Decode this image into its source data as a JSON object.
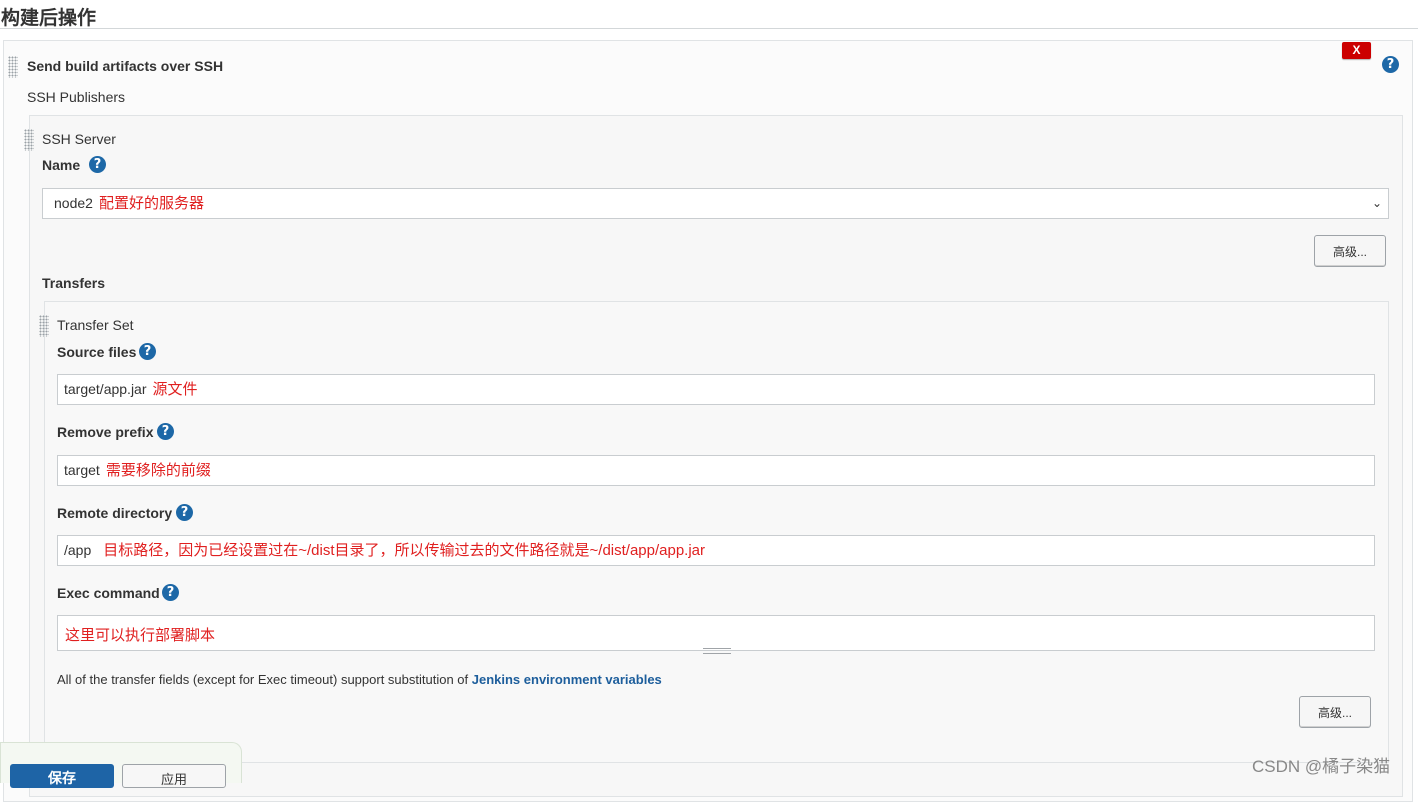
{
  "section": {
    "title": "构建后操作"
  },
  "step": {
    "title": "Send build artifacts over SSH",
    "delete_label": "X",
    "help_icon": "?",
    "publishers_label": "SSH Publishers"
  },
  "server": {
    "label": "SSH Server",
    "name_label": "Name",
    "name_value": "node2",
    "name_annotation": "配置好的服务器",
    "advanced_label": "高级..."
  },
  "transfers": {
    "label": "Transfers",
    "set_label": "Transfer Set",
    "source_files_label": "Source files",
    "source_files_value": "target/app.jar",
    "source_files_annotation": "源文件",
    "remove_prefix_label": "Remove prefix",
    "remove_prefix_value": "target",
    "remove_prefix_annotation": "需要移除的前缀",
    "remote_directory_label": "Remote directory",
    "remote_directory_value": "/app",
    "remote_directory_annotation": "目标路径，因为已经设置过在~/dist目录了，所以传输过去的文件路径就是~/dist/app/app.jar",
    "exec_command_label": "Exec command",
    "exec_command_annotation": "这里可以执行部署脚本",
    "note_text": "All of the transfer fields (except for Exec timeout) support substitution of ",
    "note_link": "Jenkins environment variables",
    "advanced_label": "高级..."
  },
  "footer": {
    "save_label": "保存",
    "apply_label": "应用"
  },
  "watermark": "CSDN @橘子染猫",
  "colors": {
    "annotation": "#e02020",
    "link": "#1d5e9c",
    "delete": "#cc0000",
    "help": "#1d68a7",
    "save": "#1e64a6"
  }
}
